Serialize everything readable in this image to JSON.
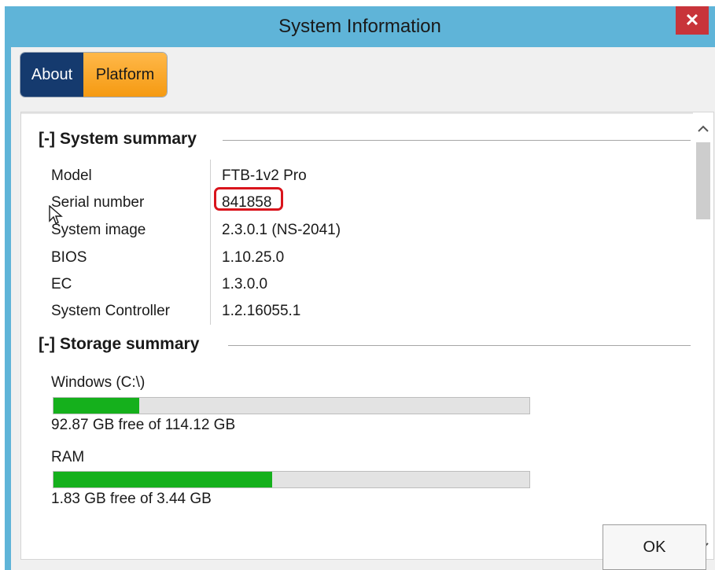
{
  "window": {
    "title": "System Information",
    "close_symbol": "✕"
  },
  "tabs": [
    {
      "label": "About",
      "selected": true
    },
    {
      "label": "Platform",
      "selected": false
    }
  ],
  "system_summary": {
    "header": "System summary",
    "toggle": "[-]",
    "rows": [
      {
        "label": "Model",
        "value": "FTB-1v2 Pro"
      },
      {
        "label": "Serial number",
        "value": "841858"
      },
      {
        "label": "System image",
        "value": "2.3.0.1 (NS-2041)"
      },
      {
        "label": "BIOS",
        "value": "1.10.25.0"
      },
      {
        "label": "EC",
        "value": "1.3.0.0"
      },
      {
        "label": "System Controller",
        "value": "1.2.16055.1"
      }
    ]
  },
  "storage_summary": {
    "header": "Storage summary",
    "toggle": "[-]",
    "items": [
      {
        "name": "Windows (C:\\)",
        "info": "92.87 GB free of 114.12 GB",
        "used_fraction": 0.18
      },
      {
        "name": "RAM",
        "info": "1.83 GB free of 3.44 GB",
        "used_fraction": 0.46
      }
    ]
  },
  "footer": {
    "ok_label": "OK"
  },
  "colors": {
    "titlebar": "#5fb4d8",
    "close": "#c8343a",
    "tab_selected": "#153a6e",
    "tab_unselected": "#f5a623",
    "bar_fill": "#15b01c",
    "highlight": "#d9141c"
  },
  "icons": [
    "close-icon",
    "chevron-up-icon",
    "chevron-down-icon",
    "mouse-cursor-icon"
  ]
}
